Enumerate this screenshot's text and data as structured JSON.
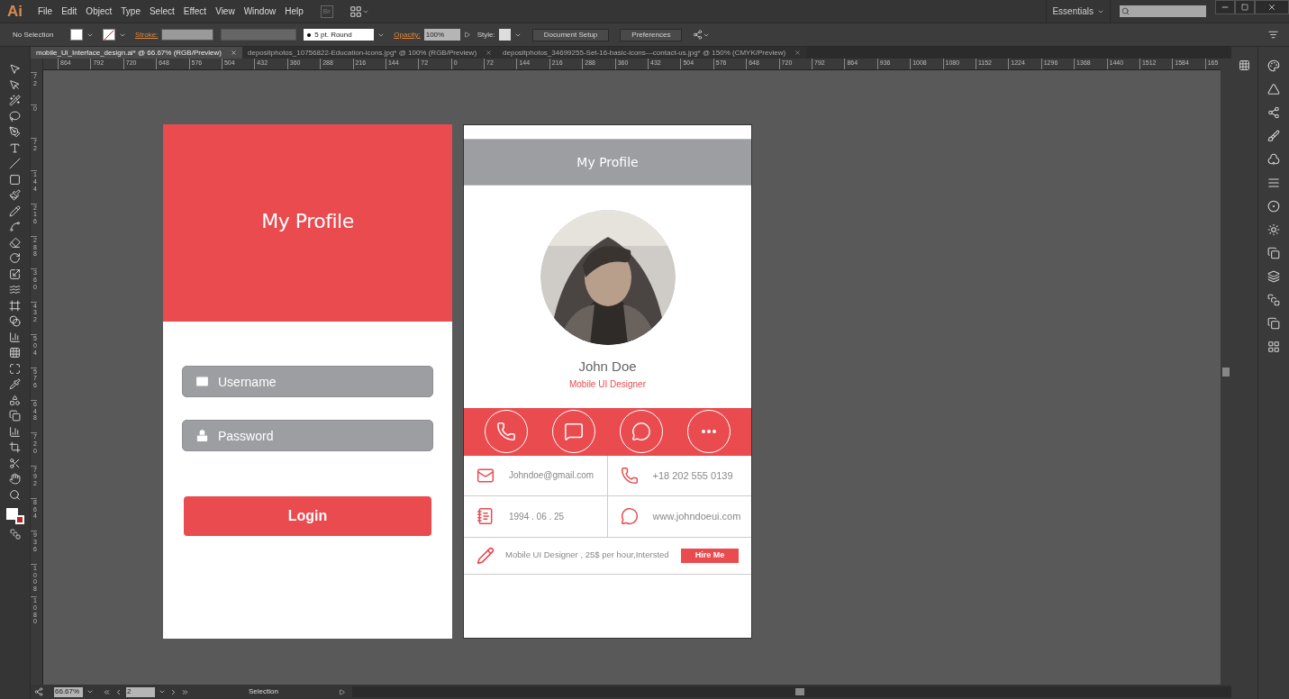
{
  "app": {
    "logo": "Ai",
    "menu": [
      "File",
      "Edit",
      "Object",
      "Type",
      "Select",
      "Effect",
      "View",
      "Window",
      "Help"
    ],
    "bridge": "Br",
    "workspace": "Essentials"
  },
  "control_bar": {
    "selection": "No Selection",
    "stroke_label": "Stroke:",
    "brush": "5 pt. Round",
    "opacity_label": "Opacity:",
    "opacity": "100%",
    "style_label": "Style:",
    "buttons": [
      "Document Setup",
      "Preferences"
    ]
  },
  "tabs": [
    {
      "label": "mobile_Ui_Interface_design.ai* @ 66.67% (RGB/Preview)",
      "selected": true
    },
    {
      "label": "depositphotos_10756822-Education-icons.jpg* @ 100% (RGB/Preview)",
      "selected": false
    },
    {
      "label": "depositphotos_34699255-Set-16-basic-icons---contact-us.jpg* @ 150% (CMYK/Preview)",
      "selected": false
    }
  ],
  "ruler": {
    "horizontal": [
      "864",
      "792",
      "720",
      "648",
      "576",
      "504",
      "432",
      "360",
      "288",
      "216",
      "144",
      "72",
      "0",
      "72",
      "144",
      "216",
      "288",
      "360",
      "432",
      "504",
      "576",
      "648",
      "720",
      "792",
      "864",
      "936",
      "1008",
      "1080",
      "1152",
      "1224",
      "1296",
      "1368",
      "1440",
      "1512",
      "1584",
      "165"
    ],
    "vertical": [
      "72",
      "0",
      "72",
      "144",
      "216",
      "288",
      "360",
      "432",
      "504",
      "576",
      "648",
      "720",
      "792",
      "864",
      "936",
      "1008",
      "1080"
    ]
  },
  "login": {
    "title": "My Profile",
    "fields": [
      {
        "kind": "mail",
        "placeholder": "Username"
      },
      {
        "kind": "lock",
        "placeholder": "Password"
      }
    ],
    "button": "Login"
  },
  "profile": {
    "header": "My Profile",
    "name": "John Doe",
    "role": "Mobile UI Designer",
    "actions": [
      {
        "kind": "phone"
      },
      {
        "kind": "chat"
      },
      {
        "kind": "screen-chat"
      },
      {
        "kind": "more"
      }
    ],
    "details": [
      {
        "kind": "mail",
        "text": "Johndoe@gmail.com"
      },
      {
        "kind": "phone",
        "text": "+18 202 555 0139"
      },
      {
        "kind": "notebook",
        "text": "1994 . 06 . 25"
      },
      {
        "kind": "screen-chat",
        "text": "www.johndoeui.com"
      }
    ],
    "bio": "Mobile UI Designer , 25$ per hour,Intersted",
    "hire": "Hire Me"
  },
  "status_bar": {
    "zoom": "66.67%",
    "artboard": "2",
    "tool": "Selection"
  }
}
